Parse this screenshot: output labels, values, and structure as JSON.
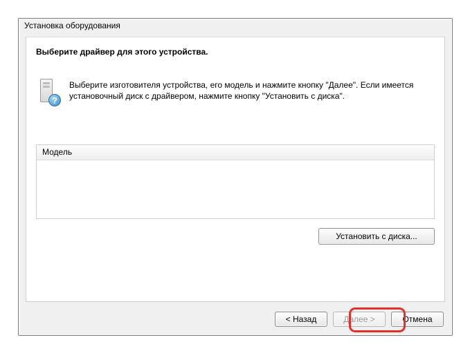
{
  "window": {
    "title": "Установка оборудования"
  },
  "page": {
    "heading": "Выберите драйвер для этого устройства.",
    "instruction": "Выберите изготовителя устройства, его модель и нажмите кнопку \"Далее\". Если имеется установочный диск с  драйвером, нажмите кнопку \"Установить с диска\"."
  },
  "list": {
    "column_model": "Модель"
  },
  "buttons": {
    "have_disk": "Установить с диска...",
    "back": "< Назад",
    "next": "Далее >",
    "cancel": "Отмена"
  },
  "icons": {
    "device_help": "?"
  }
}
